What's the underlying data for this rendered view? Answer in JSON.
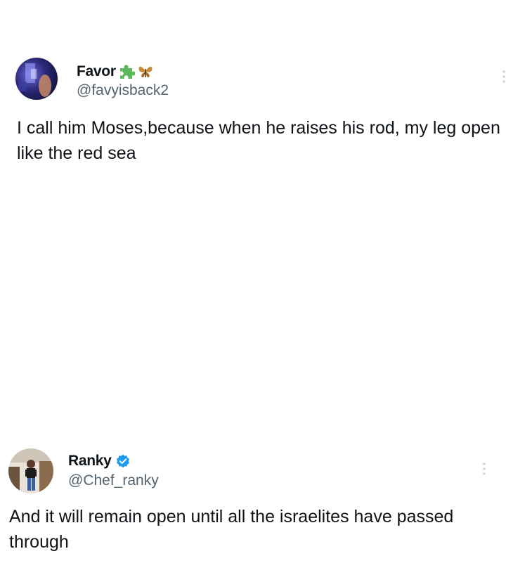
{
  "tweets": [
    {
      "display_name": "Favor",
      "name_emojis": [
        "puzzle-piece-icon",
        "butterfly-icon"
      ],
      "handle": "@favyisback2",
      "text": "I call him Moses,because when he raises his rod, my leg open like the red sea"
    },
    {
      "display_name": "Ranky",
      "verified": true,
      "handle": "@Chef_ranky",
      "text": "And it will remain open until all the israelites have passed through"
    }
  ],
  "colors": {
    "text_primary": "#0f1419",
    "text_secondary": "#536471",
    "verified_blue": "#1d9bf0",
    "puzzle_green": "#5cb85c"
  }
}
